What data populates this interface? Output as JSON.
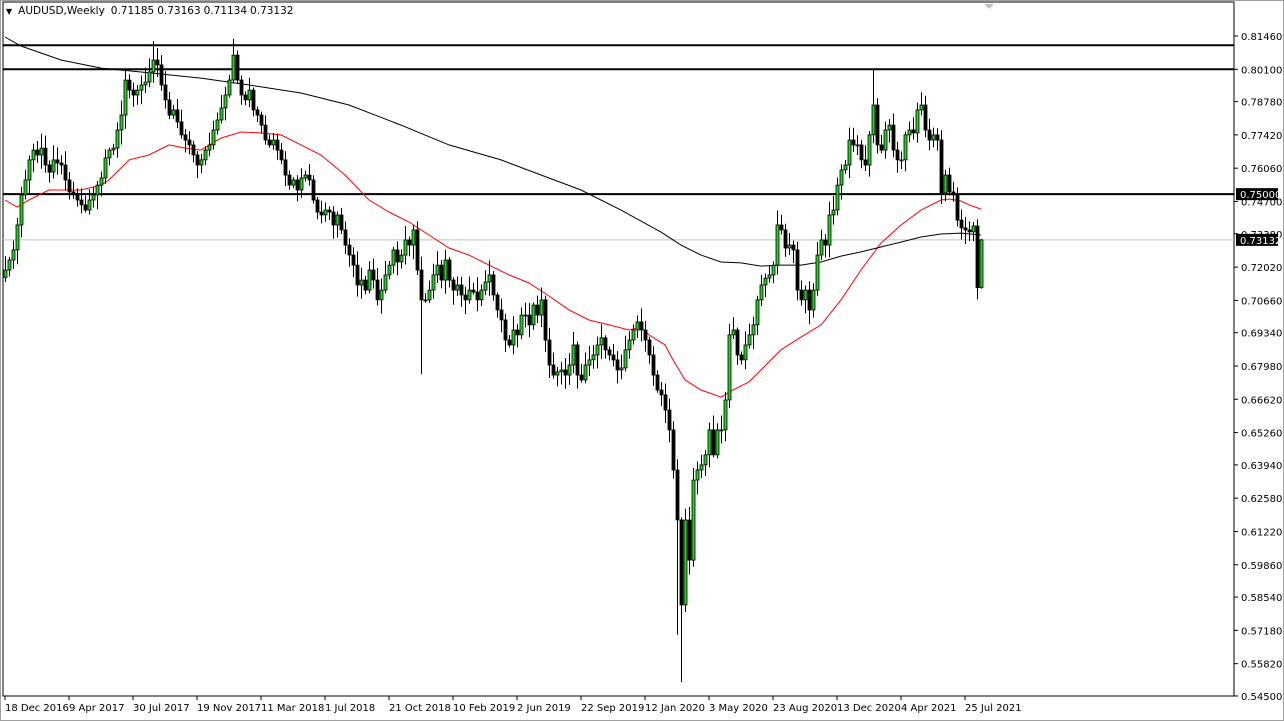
{
  "header": {
    "menu_icon": "triangle-down-icon",
    "symbol": "AUDUSD,Weekly",
    "open": "0.71185",
    "high": "0.73163",
    "low": "0.71134",
    "close": "0.73132"
  },
  "colors": {
    "bull_candle": "#22d322",
    "bear_candle": "#000000",
    "ma_fast": "#ff0000",
    "ma_slow": "#000000",
    "level_line": "#000000",
    "current_price_line": "#c0c0c0"
  },
  "chart_data": {
    "type": "candlestick",
    "title": "AUDUSD,Weekly",
    "ylim": [
      0.545,
      0.8146
    ],
    "y_ticks": [
      "0.81460",
      "0.80100",
      "0.78780",
      "0.77420",
      "0.76060",
      "0.74700",
      "0.73380",
      "0.72020",
      "0.70660",
      "0.69340",
      "0.67980",
      "0.66620",
      "0.65260",
      "0.63940",
      "0.62580",
      "0.61220",
      "0.59860",
      "0.58540",
      "0.57180",
      "0.55820",
      "0.54500"
    ],
    "x_tick_labels": [
      "18 Dec 2016",
      "9 Apr 2017",
      "30 Jul 2017",
      "19 Nov 2017",
      "11 Mar 2018",
      "1 Jul 2018",
      "21 Oct 2018",
      "10 Feb 2019",
      "2 Jun 2019",
      "22 Sep 2019",
      "12 Jan 2020",
      "3 May 2020",
      "23 Aug 2020",
      "13 Dec 2020",
      "4 Apr 2021",
      "25 Jul 2021"
    ],
    "x_tick_week_step": 16,
    "first_open": 0.716,
    "weekly_closes": [
      0.719,
      0.7231,
      0.7272,
      0.7374,
      0.7497,
      0.7558,
      0.764,
      0.768,
      0.766,
      0.7688,
      0.7619,
      0.759,
      0.764,
      0.7627,
      0.7619,
      0.7558,
      0.7509,
      0.7497,
      0.7476,
      0.7456,
      0.7435,
      0.7476,
      0.7497,
      0.7537,
      0.7566,
      0.7648,
      0.768,
      0.7688,
      0.7762,
      0.7823,
      0.7966,
      0.7925,
      0.7905,
      0.7925,
      0.7946,
      0.7958,
      0.7999,
      0.8048,
      0.8028,
      0.7946,
      0.7885,
      0.7823,
      0.7844,
      0.7795,
      0.7742,
      0.7721,
      0.7701,
      0.766,
      0.7619,
      0.764,
      0.768,
      0.7701,
      0.7762,
      0.7803,
      0.7852,
      0.7905,
      0.7966,
      0.8068,
      0.7966,
      0.7905,
      0.7885,
      0.7925,
      0.7844,
      0.7823,
      0.7782,
      0.7721,
      0.7701,
      0.7721,
      0.768,
      0.764,
      0.7578,
      0.7537,
      0.7558,
      0.7517,
      0.7566,
      0.7578,
      0.7558,
      0.7476,
      0.7427,
      0.7415,
      0.7435,
      0.7427,
      0.7374,
      0.7415,
      0.7354,
      0.7292,
      0.7251,
      0.721,
      0.7129,
      0.7149,
      0.7108,
      0.719,
      0.7149,
      0.7068,
      0.7108,
      0.717,
      0.721,
      0.7272,
      0.7223,
      0.7251,
      0.7313,
      0.7292,
      0.7354,
      0.719,
      0.7068,
      0.7068,
      0.7108,
      0.717,
      0.721,
      0.7149,
      0.7231,
      0.7149,
      0.7108,
      0.7129,
      0.7088,
      0.7068,
      0.7108,
      0.71,
      0.7068,
      0.7108,
      0.7141,
      0.717,
      0.7088,
      0.7027,
      0.6986,
      0.6904,
      0.6884,
      0.6945,
      0.6925,
      0.7006,
      0.7006,
      0.6966,
      0.7047,
      0.7006,
      0.7068,
      0.6904,
      0.6802,
      0.6761,
      0.6774,
      0.6782,
      0.6761,
      0.6802,
      0.6884,
      0.6761,
      0.6741,
      0.6802,
      0.6823,
      0.6843,
      0.6884,
      0.6913,
      0.6864,
      0.6843,
      0.6823,
      0.6782,
      0.679,
      0.6864,
      0.6904,
      0.6945,
      0.6978,
      0.6945,
      0.6904,
      0.6843,
      0.6761,
      0.67,
      0.668,
      0.6618,
      0.6537,
      0.6373,
      0.6169,
      0.5822,
      0.6169,
      0.6005,
      0.6332,
      0.6373,
      0.6394,
      0.6435,
      0.6537,
      0.6435,
      0.6537,
      0.6537,
      0.6659,
      0.6925,
      0.6945,
      0.6843,
      0.6823,
      0.6884,
      0.6925,
      0.6966,
      0.7068,
      0.7129,
      0.7157,
      0.717,
      0.721,
      0.7374,
      0.7354,
      0.728,
      0.7292,
      0.7272,
      0.7108,
      0.7068,
      0.7108,
      0.7027,
      0.7108,
      0.7251,
      0.7313,
      0.7292,
      0.7415,
      0.7435,
      0.7537,
      0.7599,
      0.7619,
      0.7721,
      0.7701,
      0.7701,
      0.764,
      0.7619,
      0.7742,
      0.7864,
      0.7701,
      0.768,
      0.7762,
      0.7782,
      0.768,
      0.764,
      0.764,
      0.7742,
      0.7762,
      0.775,
      0.7844,
      0.7864,
      0.7762,
      0.7721,
      0.7742,
      0.7721,
      0.7505,
      0.7578,
      0.7509,
      0.7497,
      0.7394,
      0.7362,
      0.7354,
      0.7346,
      0.737,
      0.7118,
      0.73132
    ],
    "last_candle": {
      "open": 0.71185,
      "high": 0.73163,
      "low": 0.71134,
      "close": 0.73132
    },
    "extremes": [
      {
        "week": 37,
        "high": 0.8125
      },
      {
        "week": 57,
        "high": 0.8135
      },
      {
        "week": 104,
        "low": 0.6765
      },
      {
        "week": 169,
        "low": 0.5506
      },
      {
        "week": 168,
        "low": 0.57
      },
      {
        "week": 217,
        "high": 0.8007
      }
    ],
    "moving_averages": [
      {
        "name": "MA fast (red)",
        "color": "#ff0000",
        "points": [
          [
            0,
            0.7476
          ],
          [
            3,
            0.7447
          ],
          [
            6,
            0.7476
          ],
          [
            11,
            0.7517
          ],
          [
            19,
            0.7517
          ],
          [
            24,
            0.7537
          ],
          [
            26,
            0.7558
          ],
          [
            31,
            0.764
          ],
          [
            36,
            0.766
          ],
          [
            41,
            0.7701
          ],
          [
            45,
            0.7688
          ],
          [
            49,
            0.768
          ],
          [
            54,
            0.7729
          ],
          [
            59,
            0.7754
          ],
          [
            64,
            0.775
          ],
          [
            69,
            0.7742
          ],
          [
            74,
            0.7701
          ],
          [
            79,
            0.766
          ],
          [
            85,
            0.7578
          ],
          [
            91,
            0.7476
          ],
          [
            96,
            0.7427
          ],
          [
            101,
            0.7386
          ],
          [
            106,
            0.7333
          ],
          [
            111,
            0.728
          ],
          [
            116,
            0.7251
          ],
          [
            121,
            0.721
          ],
          [
            126,
            0.717
          ],
          [
            131,
            0.7137
          ],
          [
            136,
            0.7084
          ],
          [
            141,
            0.7027
          ],
          [
            146,
            0.6986
          ],
          [
            151,
            0.6966
          ],
          [
            156,
            0.6945
          ],
          [
            159,
            0.6957
          ],
          [
            161,
            0.6925
          ],
          [
            165,
            0.6884
          ],
          [
            167,
            0.6823
          ],
          [
            170,
            0.6741
          ],
          [
            174,
            0.67
          ],
          [
            179,
            0.6671
          ],
          [
            182,
            0.67
          ],
          [
            186,
            0.6733
          ],
          [
            189,
            0.6782
          ],
          [
            194,
            0.6864
          ],
          [
            199,
            0.6916
          ],
          [
            204,
            0.6966
          ],
          [
            209,
            0.7068
          ],
          [
            214,
            0.719
          ],
          [
            219,
            0.73
          ],
          [
            224,
            0.7374
          ],
          [
            229,
            0.7435
          ],
          [
            234,
            0.7476
          ],
          [
            236,
            0.748
          ],
          [
            239,
            0.7472
          ],
          [
            241,
            0.7456
          ],
          [
            244,
            0.7439
          ]
        ]
      },
      {
        "name": "MA slow (black)",
        "color": "#000000",
        "points": [
          [
            0,
            0.8142
          ],
          [
            4,
            0.8105
          ],
          [
            14,
            0.8048
          ],
          [
            24,
            0.8015
          ],
          [
            34,
            0.7999
          ],
          [
            49,
            0.7974
          ],
          [
            61,
            0.7946
          ],
          [
            74,
            0.7913
          ],
          [
            86,
            0.7864
          ],
          [
            99,
            0.7782
          ],
          [
            111,
            0.7701
          ],
          [
            124,
            0.764
          ],
          [
            134,
            0.7578
          ],
          [
            144,
            0.7517
          ],
          [
            154,
            0.7435
          ],
          [
            164,
            0.7345
          ],
          [
            169,
            0.7292
          ],
          [
            174,
            0.7251
          ],
          [
            179,
            0.7223
          ],
          [
            184,
            0.7219
          ],
          [
            189,
            0.7206
          ],
          [
            194,
            0.721
          ],
          [
            199,
            0.721
          ],
          [
            204,
            0.7223
          ],
          [
            209,
            0.7247
          ],
          [
            214,
            0.7264
          ],
          [
            219,
            0.7284
          ],
          [
            224,
            0.7304
          ],
          [
            229,
            0.7325
          ],
          [
            234,
            0.7337
          ],
          [
            239,
            0.7341
          ],
          [
            244,
            0.7333
          ]
        ]
      }
    ],
    "horizontal_levels": [
      0.8108,
      0.801,
      0.75
    ],
    "highlighted_labels": [
      {
        "value": 0.75,
        "text": "0.75000"
      },
      {
        "value": 0.73132,
        "text": "0.73132"
      }
    ],
    "current_price": 0.73132
  }
}
